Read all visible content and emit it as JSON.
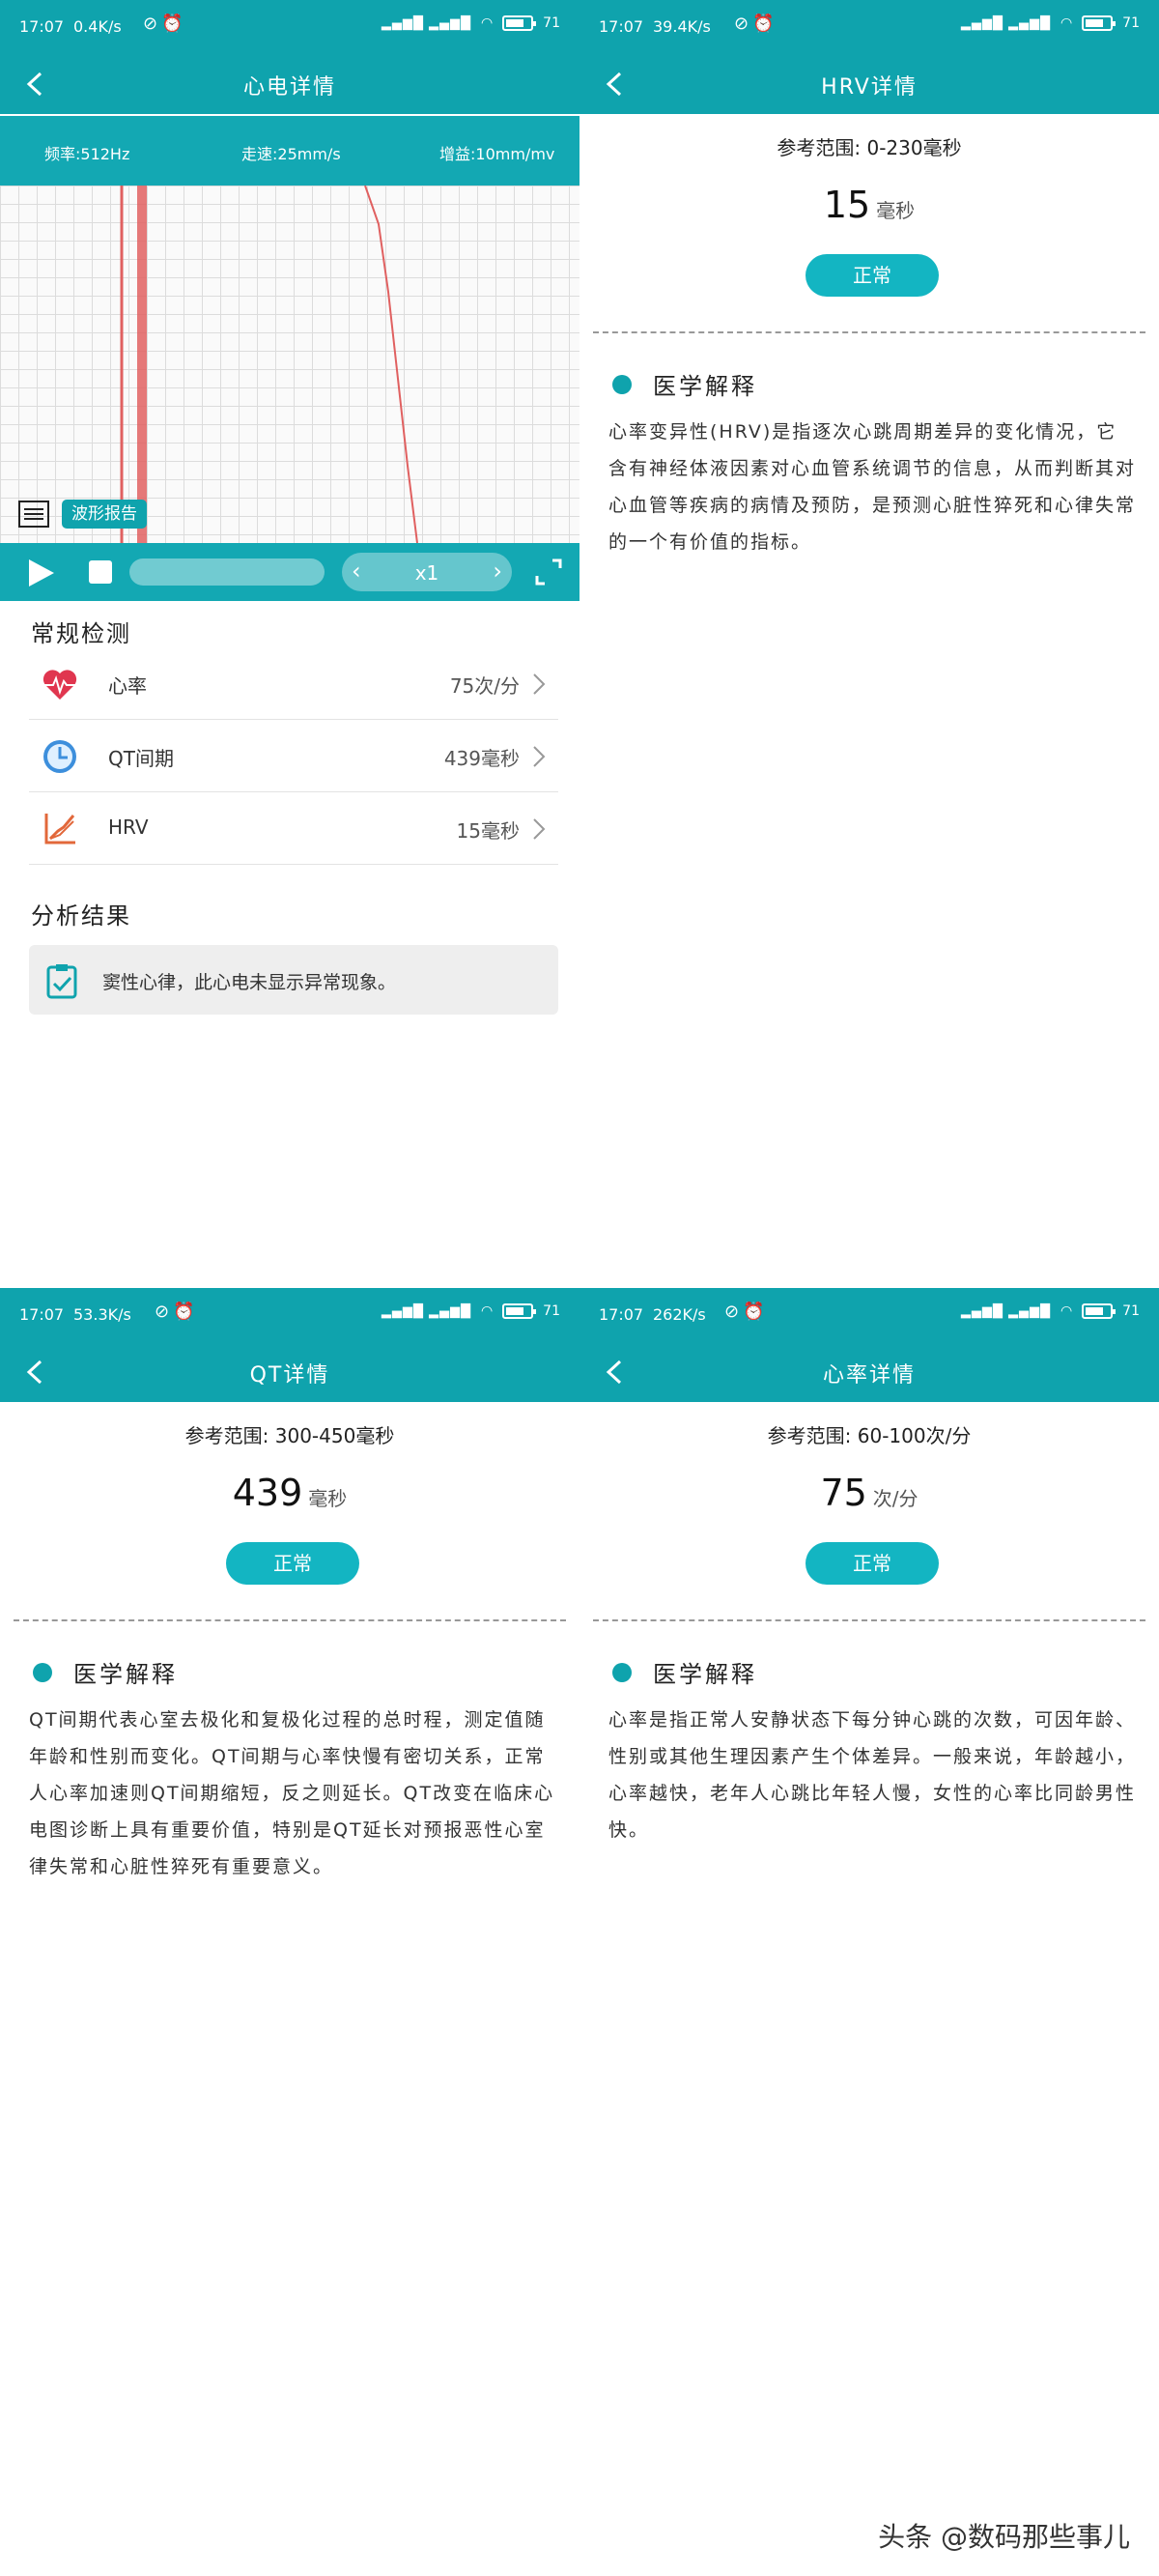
{
  "ecg_screen": {
    "status": {
      "time": "17:07",
      "net": "0.4K/s",
      "battery": "71"
    },
    "title": "心电详情",
    "info": {
      "frequency": "频率:512Hz",
      "speed": "走速:25mm/s",
      "gain": "增益:10mm/mv"
    },
    "report_label": "波形报告",
    "playback_speed": "x1",
    "section_routine": "常规检测",
    "rows": [
      {
        "label": "心率",
        "value": "75次/分",
        "icon": "heart-rate-icon"
      },
      {
        "label": "QT间期",
        "value": "439毫秒",
        "icon": "clock-icon"
      },
      {
        "label": "HRV",
        "value": "15毫秒",
        "icon": "hrv-chart-icon"
      }
    ],
    "section_analysis": "分析结果",
    "analysis_result": "窦性心律，此心电未显示异常现象。"
  },
  "hrv_screen": {
    "status": {
      "time": "17:07",
      "net": "39.4K/s",
      "battery": "71"
    },
    "title": "HRV详情",
    "reference": "参考范围: 0-230毫秒",
    "value": "15",
    "unit": "毫秒",
    "status_label": "正常",
    "med_title": "医学解释",
    "explanation": "心率变异性(HRV)是指逐次心跳周期差异的变化情况，它含有神经体液因素对心血管系统调节的信息，从而判断其对心血管等疾病的病情及预防，是预测心脏性猝死和心律失常的一个有价值的指标。"
  },
  "qt_screen": {
    "status": {
      "time": "17:07",
      "net": "53.3K/s",
      "battery": "71"
    },
    "title": "QT详情",
    "reference": "参考范围: 300-450毫秒",
    "value": "439",
    "unit": "毫秒",
    "status_label": "正常",
    "med_title": "医学解释",
    "explanation": "QT间期代表心室去极化和复极化过程的总时程，测定值随年龄和性别而变化。QT间期与心率快慢有密切关系，正常人心率加速则QT间期缩短，反之则延长。QT改变在临床心电图诊断上具有重要价值，特别是QT延长对预报恶性心室律失常和心脏性猝死有重要意义。"
  },
  "hr_screen": {
    "status": {
      "time": "17:07",
      "net": "262K/s",
      "battery": "71"
    },
    "title": "心率详情",
    "reference": "参考范围: 60-100次/分",
    "value": "75",
    "unit": "次/分",
    "status_label": "正常",
    "med_title": "医学解释",
    "explanation": "心率是指正常人安静状态下每分钟心跳的次数，可因年龄、性别或其他生理因素产生个体差异。一般来说，年龄越小，心率越快，老年人心跳比年轻人慢，女性的心率比同龄男性快。"
  },
  "watermark": "头条 @数码那些事儿",
  "colors": {
    "accent": "#0fa3ad",
    "pill": "#13b5c2",
    "ecg_line": "#e06060"
  }
}
